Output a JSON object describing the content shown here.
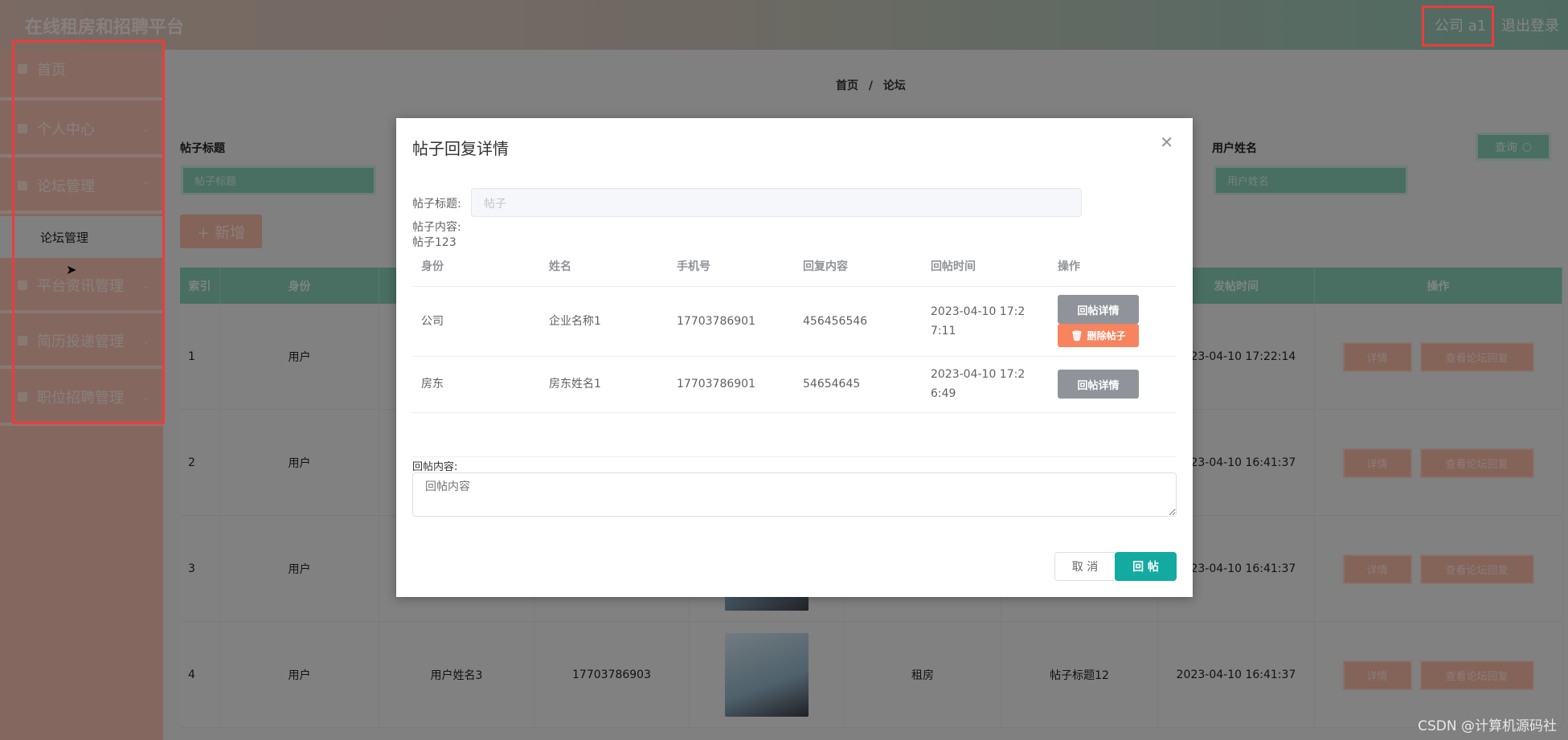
{
  "header": {
    "title": "在线租房和招聘平台",
    "user": "公司 a1",
    "logout": "退出登录"
  },
  "sidebar": {
    "items": [
      {
        "label": "首页",
        "icon": "home-icon"
      },
      {
        "label": "个人中心",
        "icon": "user-icon"
      },
      {
        "label": "论坛管理",
        "icon": "forum-icon"
      },
      {
        "label": "论坛管理",
        "sub": true
      },
      {
        "label": "平台资讯管理",
        "icon": "news-icon"
      },
      {
        "label": "简历投递管理",
        "icon": "resume-icon"
      },
      {
        "label": "职位招聘管理",
        "icon": "job-icon"
      }
    ]
  },
  "breadcrumb": {
    "home": "首页",
    "sep": "/",
    "current": "论坛"
  },
  "search": {
    "title_label": "帖子标题",
    "title_placeholder": "帖子标题",
    "name_label": "用户姓名",
    "name_placeholder": "用户姓名",
    "query": "查询"
  },
  "add_button": "+ 新增",
  "bg_table": {
    "headers": [
      "索引",
      "身份",
      "",
      "",
      "",
      "",
      "",
      "发帖时间",
      "操作"
    ],
    "rows": [
      {
        "index": "1",
        "role": "用户",
        "name": "",
        "phone": "",
        "type": "",
        "title": "",
        "time": "2023-04-10 17:22:14"
      },
      {
        "index": "2",
        "role": "用户",
        "name": "",
        "phone": "",
        "type": "",
        "title": "",
        "time": "2023-04-10 16:41:37"
      },
      {
        "index": "3",
        "role": "用户",
        "name": "",
        "phone": "",
        "type": "",
        "title": "",
        "time": "2023-04-10 16:41:37"
      },
      {
        "index": "4",
        "role": "用户",
        "name": "用户姓名3",
        "phone": "17703786903",
        "type": "租房",
        "title": "帖子标题12",
        "time": "2023-04-10 16:41:37"
      }
    ],
    "detail": "详情",
    "view_replies": "查看论坛回复"
  },
  "modal": {
    "title": "帖子回复详情",
    "post_title_label": "帖子标题:",
    "post_title_placeholder": "帖子",
    "post_content_label": "帖子内容:",
    "post_content": "帖子123",
    "columns": [
      "身份",
      "姓名",
      "手机号",
      "回复内容",
      "回帖时间",
      "操作"
    ],
    "rows": [
      {
        "role": "公司",
        "name": "企业名称1",
        "phone": "17703786901",
        "content": "456456546",
        "time": "2023-04-10 17:27:11",
        "detail": "回帖详情",
        "delete": "删除帖子"
      },
      {
        "role": "房东",
        "name": "房东姓名1",
        "phone": "17703786901",
        "content": "54654645",
        "time": "2023-04-10 17:26:49",
        "detail": "回帖详情"
      }
    ],
    "reply_label": "回帖内容:",
    "reply_placeholder": "回帖内容",
    "cancel": "取 消",
    "submit": "回 帖"
  },
  "watermark": "CSDN @计算机源码社",
  "colors": {
    "accent": "#13aaa1",
    "danger": "#f7845e",
    "highlight_box": "#ee3b3b"
  }
}
